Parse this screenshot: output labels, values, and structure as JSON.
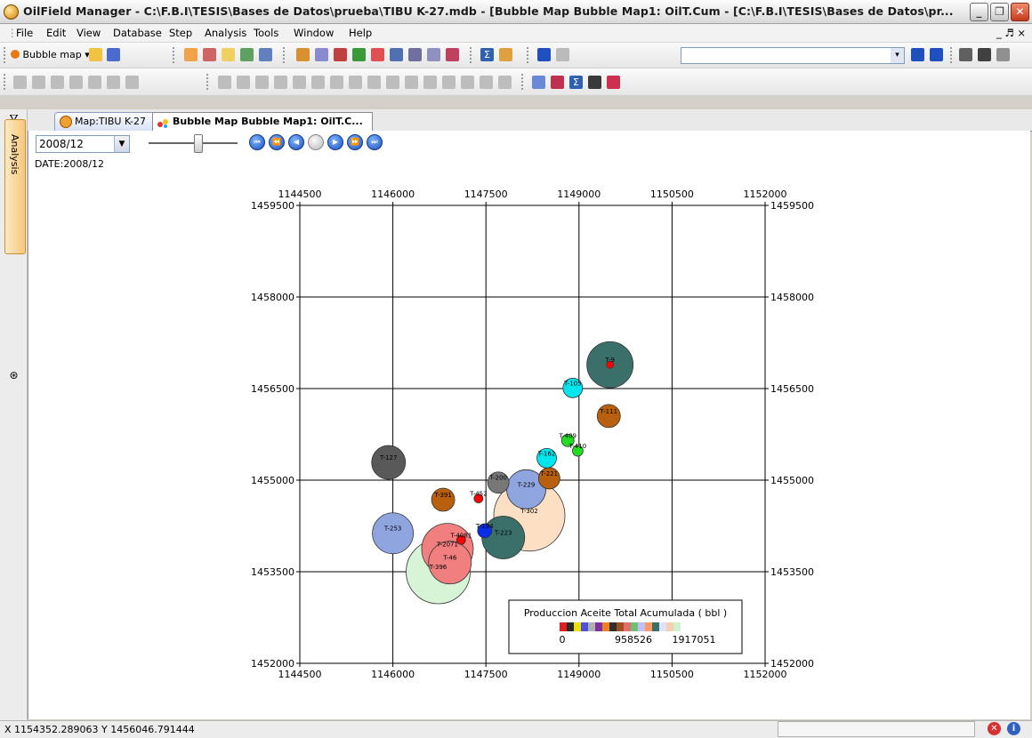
{
  "window": {
    "title": "OilField Manager - C:\\F.B.I\\TESIS\\Bases de Datos\\prueba\\TIBU K-27.mdb - [Bubble Map Bubble Map1:  OilT.Cum - [C:\\F.B.I\\TESIS\\Bases de Datos\\pr...",
    "icons": [
      "app-icon",
      "minimize-icon",
      "restore-icon",
      "close-icon"
    ]
  },
  "menu": [
    "File",
    "Edit",
    "View",
    "Database",
    "Step",
    "Analysis",
    "Tools",
    "Window",
    "Help"
  ],
  "menu_right": "_ ♬ ×",
  "toolbar": {
    "bubble_dropdown_label": "Bubble map"
  },
  "sidebar": {
    "analysis_label": "Analysis"
  },
  "tabs": [
    {
      "label": "Map:TIBU K-27"
    },
    {
      "label": "Bubble Map Bubble Map1:  OilT.C..."
    }
  ],
  "controls": {
    "date_value": "2008/12",
    "slider_fraction": 0.55,
    "date_label": "DATE:2008/12"
  },
  "map": {
    "x_ticks": [
      "1144500",
      "1146000",
      "1147500",
      "1149000",
      "1150500",
      "1152000"
    ],
    "y_ticks": [
      "1459500",
      "1458000",
      "1456500",
      "1455000",
      "1453500",
      "1452000"
    ],
    "x_range": [
      1144500,
      1152000
    ],
    "y_range": [
      1452000,
      1459500
    ],
    "legend": {
      "title": "Produccion Aceite Total Acumulada ( bbl )",
      "labels": [
        "0",
        "958526",
        "1917051"
      ]
    },
    "wells": [
      {
        "name": "T-9",
        "x": 1149500,
        "y": 1456890,
        "r": 26,
        "color": "#3b6f6a",
        "dot": "#ff0000"
      },
      {
        "name": "T-105",
        "x": 1148900,
        "y": 1456510,
        "r": 11,
        "color": "#00e5ee",
        "dot": ""
      },
      {
        "name": "T-111",
        "x": 1149480,
        "y": 1456050,
        "r": 13,
        "color": "#b8600e",
        "dot": ""
      },
      {
        "name": "T-409",
        "x": 1148820,
        "y": 1455650,
        "r": 7,
        "color": "#22dd22",
        "dot": ""
      },
      {
        "name": "T-410",
        "x": 1148980,
        "y": 1455480,
        "r": 6,
        "color": "#22dd22",
        "dot": ""
      },
      {
        "name": "T-162",
        "x": 1148480,
        "y": 1455360,
        "r": 11,
        "color": "#00e5ee",
        "dot": ""
      },
      {
        "name": "T-127",
        "x": 1145930,
        "y": 1455290,
        "r": 19,
        "color": "#595959",
        "dot": ""
      },
      {
        "name": "T-221",
        "x": 1148520,
        "y": 1455030,
        "r": 12,
        "color": "#b8600e",
        "dot": ""
      },
      {
        "name": "T-200",
        "x": 1147700,
        "y": 1454960,
        "r": 12,
        "color": "#777777",
        "dot": ""
      },
      {
        "name": "T-229",
        "x": 1148150,
        "y": 1454850,
        "r": 22,
        "color": "#8fa5e0",
        "dot": ""
      },
      {
        "name": "T-391",
        "x": 1146810,
        "y": 1454680,
        "r": 13,
        "color": "#b8600e",
        "dot": ""
      },
      {
        "name": "T-452",
        "x": 1147380,
        "y": 1454700,
        "r": 5,
        "color": "#ff0000",
        "dot": ""
      },
      {
        "name": "T-302",
        "x": 1148200,
        "y": 1454420,
        "r": 40,
        "color": "#fde0c4",
        "dot": ""
      },
      {
        "name": "T-253",
        "x": 1146000,
        "y": 1454130,
        "r": 23,
        "color": "#8fa5e0",
        "dot": ""
      },
      {
        "name": "T-4081",
        "x": 1147100,
        "y": 1454020,
        "r": 5,
        "color": "#ff0000",
        "dot": ""
      },
      {
        "name": "T-194",
        "x": 1147480,
        "y": 1454170,
        "r": 8,
        "color": "#0a2ee8",
        "dot": ""
      },
      {
        "name": "T-223",
        "x": 1147780,
        "y": 1454060,
        "r": 24,
        "color": "#3b6f6a",
        "dot": ""
      },
      {
        "name": "T-396",
        "x": 1146730,
        "y": 1453500,
        "r": 36,
        "color": "#d7f5d6",
        "dot": ""
      },
      {
        "name": "T-2071",
        "x": 1146880,
        "y": 1453870,
        "r": 29,
        "color": "#f27f7f",
        "dot": ""
      },
      {
        "name": "T-46",
        "x": 1146920,
        "y": 1453650,
        "r": 24,
        "color": "#f27f7f",
        "dot": ""
      }
    ]
  },
  "status": {
    "coords": "X 1154352.289063  Y 1456046.791444"
  }
}
